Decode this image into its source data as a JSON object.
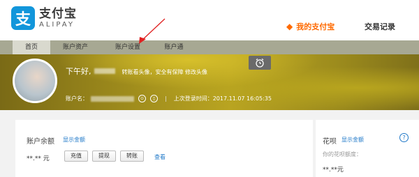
{
  "logo": {
    "mark": "支",
    "name_cn": "支付宝",
    "name_en": "ALIPAY"
  },
  "nav": {
    "active": "我的支付宝",
    "other": "交易记录"
  },
  "subnav": [
    "首页",
    "账户资产",
    "账户设置",
    "账户通"
  ],
  "banner": {
    "greeting": "下午好,",
    "tip": "转账看头像，安全有保障 修改头像",
    "account_label": "账户名：",
    "last_login": "上次登录时间：2017.11.07 16:05:35"
  },
  "account": {
    "title": "账户余额",
    "show_amount": "显示金额",
    "balance": "**.** 元",
    "buttons": [
      "充值",
      "提现",
      "转账"
    ],
    "view": "查看"
  },
  "huabei": {
    "title": "花呗",
    "show_amount": "显示金额",
    "help": "?",
    "quota_label": "你的花呗额度：",
    "quota_value": "**.**元"
  },
  "colors": {
    "accent": "#ff6a00",
    "link": "#1f78c8",
    "brand": "#1296db",
    "annotation": "#e02020"
  },
  "icons": [
    "alipay-logo-icon",
    "alarm-clock-icon",
    "security-icon",
    "phone-icon",
    "help-icon",
    "red-arrow-annotation"
  ]
}
